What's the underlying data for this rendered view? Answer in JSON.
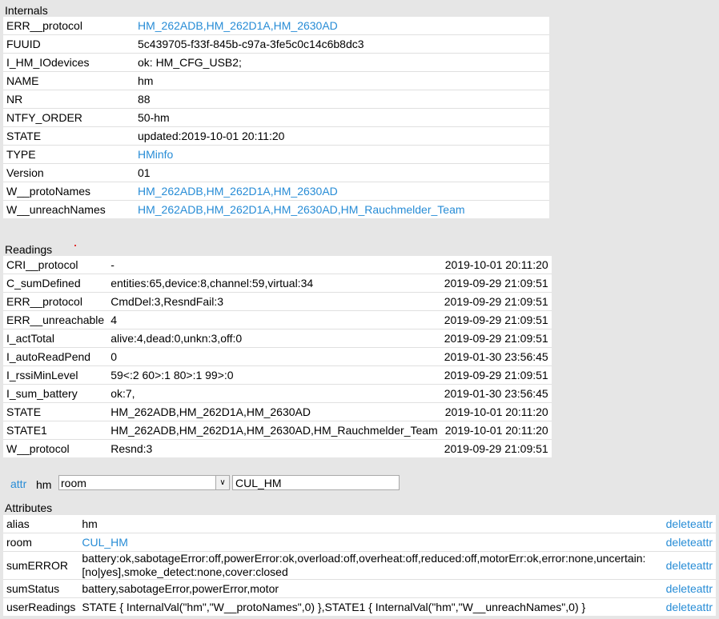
{
  "internals": {
    "title": "Internals",
    "rows": [
      {
        "key": "ERR__protocol",
        "value": "HM_262ADB,HM_262D1A,HM_2630AD",
        "link": true
      },
      {
        "key": "FUUID",
        "value": "5c439705-f33f-845b-c97a-3fe5c0c14c6b8dc3",
        "link": false
      },
      {
        "key": "I_HM_IOdevices",
        "value": "ok: HM_CFG_USB2;",
        "link": false
      },
      {
        "key": "NAME",
        "value": "hm",
        "link": false
      },
      {
        "key": "NR",
        "value": "88",
        "link": false
      },
      {
        "key": "NTFY_ORDER",
        "value": "50-hm",
        "link": false
      },
      {
        "key": "STATE",
        "value": "updated:2019-10-01 20:11:20",
        "link": false
      },
      {
        "key": "TYPE",
        "value": "HMinfo",
        "link": true
      },
      {
        "key": "Version",
        "value": "01",
        "link": false
      },
      {
        "key": "W__protoNames",
        "value": "HM_262ADB,HM_262D1A,HM_2630AD",
        "link": true
      },
      {
        "key": "W__unreachNames",
        "value": "HM_262ADB,HM_262D1A,HM_2630AD,HM_Rauchmelder_Team",
        "link": true
      }
    ]
  },
  "readings": {
    "title": "Readings",
    "rows": [
      {
        "key": "CRI__protocol",
        "value": "-",
        "time": "2019-10-01 20:11:20"
      },
      {
        "key": "C_sumDefined",
        "value": "entities:65,device:8,channel:59,virtual:34",
        "time": "2019-09-29 21:09:51"
      },
      {
        "key": "ERR__protocol",
        "value": "CmdDel:3,ResndFail:3",
        "time": "2019-09-29 21:09:51"
      },
      {
        "key": "ERR__unreachable",
        "value": "4",
        "time": "2019-09-29 21:09:51"
      },
      {
        "key": "I_actTotal",
        "value": "alive:4,dead:0,unkn:3,off:0",
        "time": "2019-09-29 21:09:51"
      },
      {
        "key": "I_autoReadPend",
        "value": "0",
        "time": "2019-01-30 23:56:45"
      },
      {
        "key": "I_rssiMinLevel",
        "value": "59<:2 60>:1 80>:1 99>:0",
        "time": "2019-09-29 21:09:51"
      },
      {
        "key": "I_sum_battery",
        "value": "ok:7,",
        "time": "2019-01-30 23:56:45"
      },
      {
        "key": "STATE",
        "value": "HM_262ADB,HM_262D1A,HM_2630AD",
        "time": "2019-10-01 20:11:20"
      },
      {
        "key": "STATE1",
        "value": "HM_262ADB,HM_262D1A,HM_2630AD,HM_Rauchmelder_Team",
        "time": "2019-10-01 20:11:20"
      },
      {
        "key": "W__protocol",
        "value": "Resnd:3",
        "time": "2019-09-29 21:09:51"
      }
    ]
  },
  "attrbar": {
    "link_label": "attr",
    "device": "hm",
    "selected": "room",
    "input_value": "CUL_HM"
  },
  "attributes": {
    "title": "Attributes",
    "delete_label": "deleteattr",
    "rows": [
      {
        "key": "alias",
        "value": "hm",
        "link": false
      },
      {
        "key": "room",
        "value": "CUL_HM",
        "link": true
      },
      {
        "key": "sumERROR",
        "value": "battery:ok,sabotageError:off,powerError:ok,overload:off,overheat:off,reduced:off,motorErr:ok,error:none,uncertain:[no|yes],smoke_detect:none,cover:closed",
        "link": false
      },
      {
        "key": "sumStatus",
        "value": "battery,sabotageError,powerError,motor",
        "link": false
      },
      {
        "key": "userReadings",
        "value": "STATE { InternalVal(\"hm\",\"W__protoNames\",0) },STATE1 { InternalVal(\"hm\",\"W__unreachNames\",0) }",
        "link": false
      }
    ]
  }
}
